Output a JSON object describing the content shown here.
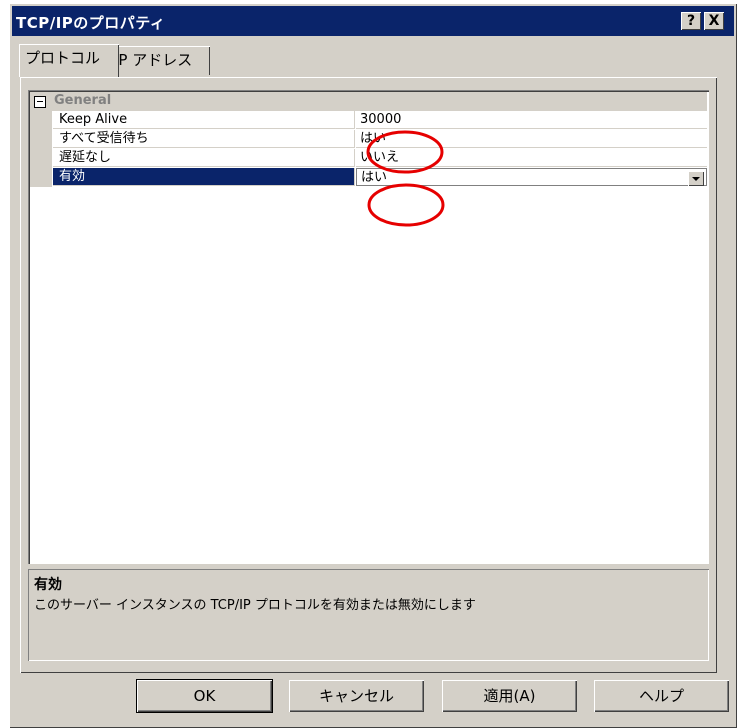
{
  "window": {
    "title": "TCP/IPのプロパティ",
    "help_label": "?",
    "close_label": "X"
  },
  "tabs": [
    {
      "label": "プロトコル",
      "active": true
    },
    {
      "label": "IP アドレス",
      "active": false
    }
  ],
  "grid": {
    "category": "General",
    "rows": [
      {
        "name": "Keep Alive",
        "value": "30000"
      },
      {
        "name": "すべて受信待ち",
        "value": "はい"
      },
      {
        "name": "遅延なし",
        "value": "いいえ"
      },
      {
        "name": "有効",
        "value": "はい",
        "selected": true
      }
    ]
  },
  "description": {
    "title": "有効",
    "text": "このサーバー インスタンスの TCP/IP プロトコルを有効または無効にします"
  },
  "buttons": {
    "ok": "OK",
    "cancel": "キャンセル",
    "apply": "適用(A)",
    "help": "ヘルプ"
  },
  "colors": {
    "titlebar": "#0a246a",
    "face": "#d4d0c8",
    "annotation": "#e60000"
  }
}
